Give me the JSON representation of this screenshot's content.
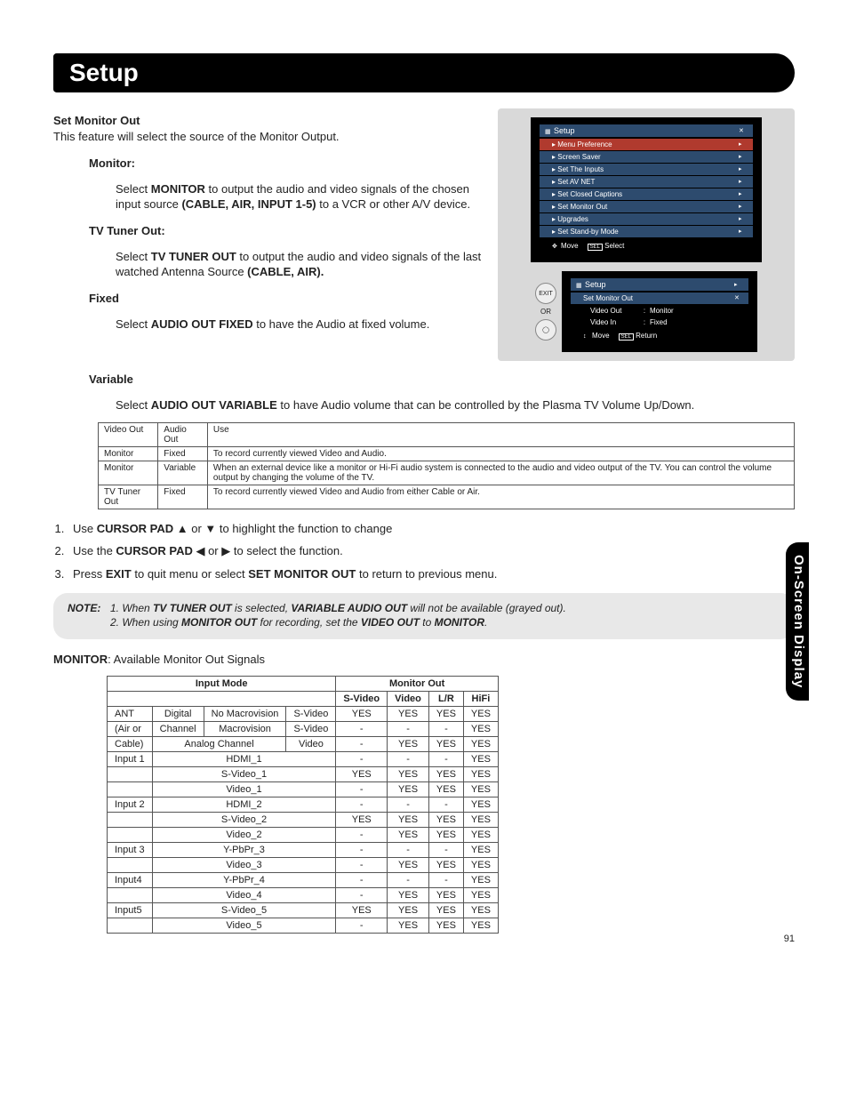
{
  "page_title": "Setup",
  "side_tab": "On-Screen Display",
  "page_number": "91",
  "set_monitor_out": {
    "heading": "Set Monitor Out",
    "intro": "This feature will select the source of the Monitor Output.",
    "monitor": {
      "term": "Monitor",
      "text_pre": "Select ",
      "bold1": "MONITOR",
      "text_mid": " to output the audio and video signals of the chosen input source ",
      "bold2": "(CABLE, AIR, INPUT 1-5)",
      "text_post": " to a VCR or other A/V device."
    },
    "tv_tuner": {
      "term": "TV Tuner Out:",
      "text_pre": "Select ",
      "bold1": "TV TUNER OUT",
      "text_mid": " to output the audio and video signals of the last watched Antenna Source ",
      "bold2": "(CABLE, AIR)."
    },
    "fixed": {
      "term": "Fixed",
      "text_pre": "Select ",
      "bold1": "AUDIO OUT FIXED",
      "text_post": " to have the Audio at fixed volume."
    },
    "variable": {
      "term": "Variable",
      "text_pre": "Select ",
      "bold1": "AUDIO OUT VARIABLE",
      "text_post": " to have Audio volume that can be controlled by the Plasma TV Volume Up/Down."
    }
  },
  "combo_table": {
    "headers": [
      "Video Out",
      "Audio Out",
      "Use"
    ],
    "rows": [
      [
        "Monitor",
        "Fixed",
        "To record currently viewed Video and Audio."
      ],
      [
        "Monitor",
        "Variable",
        "When an external device like a monitor or Hi-Fi audio system is connected to the audio and video output of the TV. You can control the volume output by changing the volume of the TV."
      ],
      [
        "TV Tuner Out",
        "Fixed",
        "To record currently viewed Video and Audio from either Cable or Air."
      ]
    ]
  },
  "steps": [
    {
      "pre": "Use ",
      "b1": "CURSOR PAD",
      "mid": " ▲ or ▼ to highlight the function to change"
    },
    {
      "pre": "Use the ",
      "b1": "CURSOR PAD",
      "mid": " ◀ or ▶ to select the function."
    },
    {
      "pre": "Press ",
      "b1": "EXIT",
      "mid": " to quit menu or select ",
      "b2": "SET MONITOR OUT",
      "post": " to return to previous menu."
    }
  ],
  "note": {
    "label": "NOTE:",
    "items": [
      {
        "pre": "When ",
        "b1": "TV TUNER OUT",
        "mid": " is selected, ",
        "b2": "VARIABLE AUDIO OUT",
        "post": " will not be available (grayed out)."
      },
      {
        "pre": "When using ",
        "b1": "MONITOR OUT",
        "mid": " for recording, set the ",
        "b2": "VIDEO OUT",
        "post": " to ",
        "b3": "MONITOR",
        "post2": "."
      }
    ]
  },
  "signals": {
    "caption_lead": "MONITOR",
    "caption": ":  Available Monitor Out Signals",
    "head_top_left": "Input Mode",
    "head_top_right": "Monitor Out",
    "head_right_cols": [
      "S-Video",
      "Video",
      "L/R",
      "HiFi"
    ],
    "rows": [
      {
        "c1": "ANT",
        "c2": "Digital",
        "c3": "No Macrovision",
        "c4": "S-Video",
        "v": [
          "YES",
          "YES",
          "YES",
          "YES"
        ]
      },
      {
        "c1": "(Air or",
        "c2": "Channel",
        "c3": "Macrovision",
        "c4": "S-Video",
        "v": [
          "-",
          "-",
          "-",
          "YES"
        ]
      },
      {
        "c1": "Cable)",
        "c2_3": "Analog Channel",
        "c4": "Video",
        "v": [
          "-",
          "YES",
          "YES",
          "YES"
        ]
      },
      {
        "c1": "Input 1",
        "c2_4": "HDMI_1",
        "v": [
          "-",
          "-",
          "-",
          "YES"
        ]
      },
      {
        "c1": "",
        "c2_4": "S-Video_1",
        "v": [
          "YES",
          "YES",
          "YES",
          "YES"
        ]
      },
      {
        "c1": "",
        "c2_4": "Video_1",
        "v": [
          "-",
          "YES",
          "YES",
          "YES"
        ]
      },
      {
        "c1": "Input 2",
        "c2_4": "HDMI_2",
        "v": [
          "-",
          "-",
          "-",
          "YES"
        ]
      },
      {
        "c1": "",
        "c2_4": "S-Video_2",
        "v": [
          "YES",
          "YES",
          "YES",
          "YES"
        ]
      },
      {
        "c1": "",
        "c2_4": "Video_2",
        "v": [
          "-",
          "YES",
          "YES",
          "YES"
        ]
      },
      {
        "c1": "Input 3",
        "c2_4": "Y-PbPr_3",
        "v": [
          "-",
          "-",
          "-",
          "YES"
        ]
      },
      {
        "c1": "",
        "c2_4": "Video_3",
        "v": [
          "-",
          "YES",
          "YES",
          "YES"
        ]
      },
      {
        "c1": "Input4",
        "c2_4": "Y-PbPr_4",
        "v": [
          "-",
          "-",
          "-",
          "YES"
        ]
      },
      {
        "c1": "",
        "c2_4": "Video_4",
        "v": [
          "-",
          "YES",
          "YES",
          "YES"
        ]
      },
      {
        "c1": "Input5",
        "c2_4": "S-Video_5",
        "v": [
          "YES",
          "YES",
          "YES",
          "YES"
        ]
      },
      {
        "c1": "",
        "c2_4": "Video_5",
        "v": [
          "-",
          "YES",
          "YES",
          "YES"
        ]
      }
    ]
  },
  "osd1": {
    "title": "Setup",
    "items": [
      "Menu Preference",
      "Screen Saver",
      "Set The Inputs",
      "Set AV NET",
      "Set Closed Captions",
      "Set Monitor Out",
      "Upgrades",
      "Set Stand-by Mode"
    ],
    "selected": "Menu Preference",
    "foot_move": "Move",
    "foot_sel": "Select",
    "sel_tag": "SEL"
  },
  "osd2": {
    "title": "Setup",
    "sub_title": "Set Monitor Out",
    "rows": [
      {
        "k": "Video Out",
        "sep": ":",
        "v": "Monitor"
      },
      {
        "k": "Video In",
        "sep": ":",
        "v": "Fixed"
      }
    ],
    "foot_move": "Move",
    "foot_ret": "Return",
    "sel_tag": "SEL"
  },
  "or_label": "OR",
  "exit_label": "EXIT"
}
